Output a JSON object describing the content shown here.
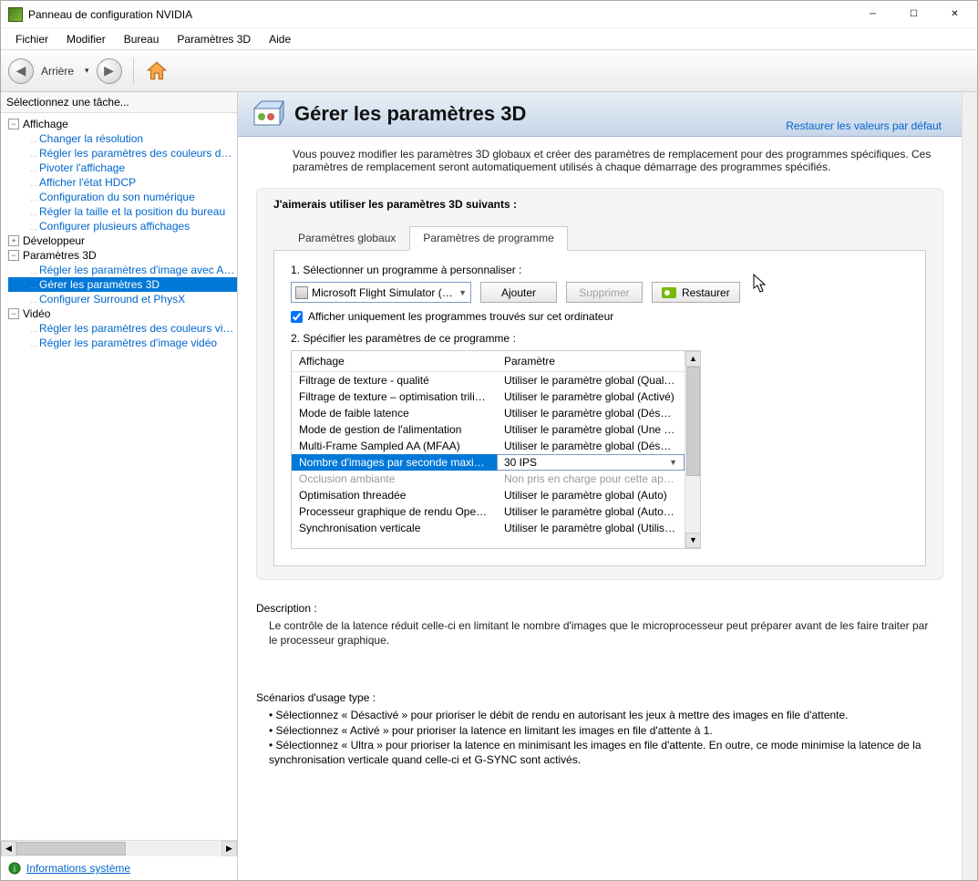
{
  "window": {
    "title": "Panneau de configuration NVIDIA"
  },
  "menubar": [
    "Fichier",
    "Modifier",
    "Bureau",
    "Paramètres 3D",
    "Aide"
  ],
  "toolbar": {
    "back": "Arrière",
    "dropdown_icon": "▾"
  },
  "sidebar": {
    "head": "Sélectionnez une tâche...",
    "groups": [
      {
        "label": "Affichage",
        "expanded": true,
        "items": [
          "Changer la résolution",
          "Régler les paramètres des couleurs du bureau",
          "Pivoter l'affichage",
          "Afficher l'état HDCP",
          "Configuration du son numérique",
          "Régler la taille et la position du bureau",
          "Configurer plusieurs affichages"
        ]
      },
      {
        "label": "Développeur",
        "expanded": false,
        "items": []
      },
      {
        "label": "Paramètres 3D",
        "expanded": true,
        "items": [
          "Régler les paramètres d'image avec Aperçu",
          "Gérer les paramètres 3D",
          "Configurer Surround et PhysX"
        ],
        "selected_index": 1
      },
      {
        "label": "Vidéo",
        "expanded": true,
        "items": [
          "Régler les paramètres des couleurs vidéo",
          "Régler les paramètres d'image vidéo"
        ]
      }
    ],
    "footer_link": "Informations système"
  },
  "main": {
    "title": "Gérer les paramètres 3D",
    "restore_link": "Restaurer les valeurs par défaut",
    "intro": "Vous pouvez modifier les paramètres 3D globaux et créer des paramètres de remplacement pour des programmes spécifiques. Ces paramètres de remplacement seront automatiquement utilisés à chaque démarrage des programmes spécifiés.",
    "panel_head": "J'aimerais utiliser les paramètres 3D suivants :",
    "tabs": {
      "global": "Paramètres globaux",
      "program": "Paramètres de programme",
      "active": "program"
    },
    "step1": "1. Sélectionner un programme à personnaliser :",
    "program_select": "Microsoft Flight Simulator (Micro...",
    "btn_add": "Ajouter",
    "btn_remove": "Supprimer",
    "btn_restore": "Restaurer",
    "checkbox_label": "Afficher uniquement les programmes trouvés sur cet ordinateur",
    "checkbox_checked": true,
    "step2": "2. Spécifier les paramètres de ce programme :",
    "table": {
      "col1": "Affichage",
      "col2": "Paramètre",
      "rows": [
        {
          "f": "Filtrage de texture - qualité",
          "v": "Utiliser le paramètre global (Qualité)"
        },
        {
          "f": "Filtrage de texture – optimisation trilinéaire",
          "v": "Utiliser le paramètre global (Activé)"
        },
        {
          "f": "Mode de faible latence",
          "v": "Utiliser le paramètre global (Désactivé)"
        },
        {
          "f": "Mode de gestion de l'alimentation",
          "v": "Utiliser le paramètre global (Une puissance..."
        },
        {
          "f": "Multi-Frame Sampled AA (MFAA)",
          "v": "Utiliser le paramètre global (Désactivé)"
        },
        {
          "f": "Nombre d'images par seconde maximal",
          "v": "30 IPS",
          "selected": true
        },
        {
          "f": "Occlusion ambiante",
          "v": "Non pris en charge pour cette application",
          "disabled": true
        },
        {
          "f": "Optimisation threadée",
          "v": "Utiliser le paramètre global (Auto)"
        },
        {
          "f": "Processeur graphique de rendu OpenGL",
          "v": "Utiliser le paramètre global (Autosélection)"
        },
        {
          "f": "Synchronisation verticale",
          "v": "Utiliser le paramètre global (Utiliser le para..."
        }
      ]
    },
    "description": {
      "head": "Description :",
      "body": "Le contrôle de la latence réduit celle-ci en limitant le nombre d'images que le microprocesseur peut préparer avant de les faire traiter par le processeur graphique."
    },
    "scenarios": {
      "head": "Scénarios d'usage type :",
      "items": [
        "• Sélectionnez « Désactivé » pour prioriser le débit de rendu en autorisant les jeux à mettre des images en file d'attente.",
        "• Sélectionnez « Activé » pour prioriser la latence en limitant les images en file d'attente à 1.",
        "• Sélectionnez « Ultra » pour prioriser la latence en minimisant les images en file d'attente. En outre, ce mode minimise la latence de la synchronisation verticale quand celle-ci et G-SYNC sont activés."
      ]
    }
  }
}
